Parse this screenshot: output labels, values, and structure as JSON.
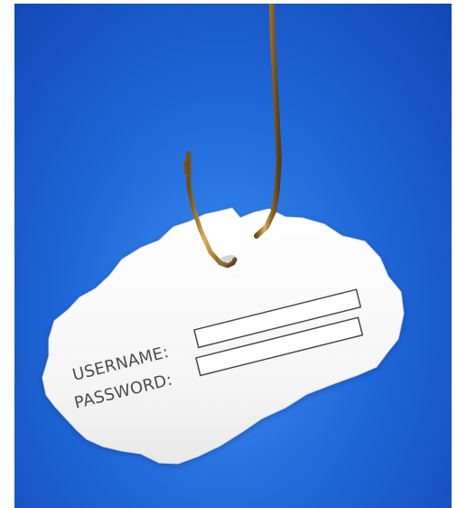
{
  "image": {
    "subject": "phishing-hook-login",
    "background_color": "#1f67d8",
    "paper_color": "#f8f8f8",
    "hook_color": "#b48c32"
  },
  "form": {
    "username_label": "USERNAME:",
    "password_label": "PASSWORD:"
  }
}
